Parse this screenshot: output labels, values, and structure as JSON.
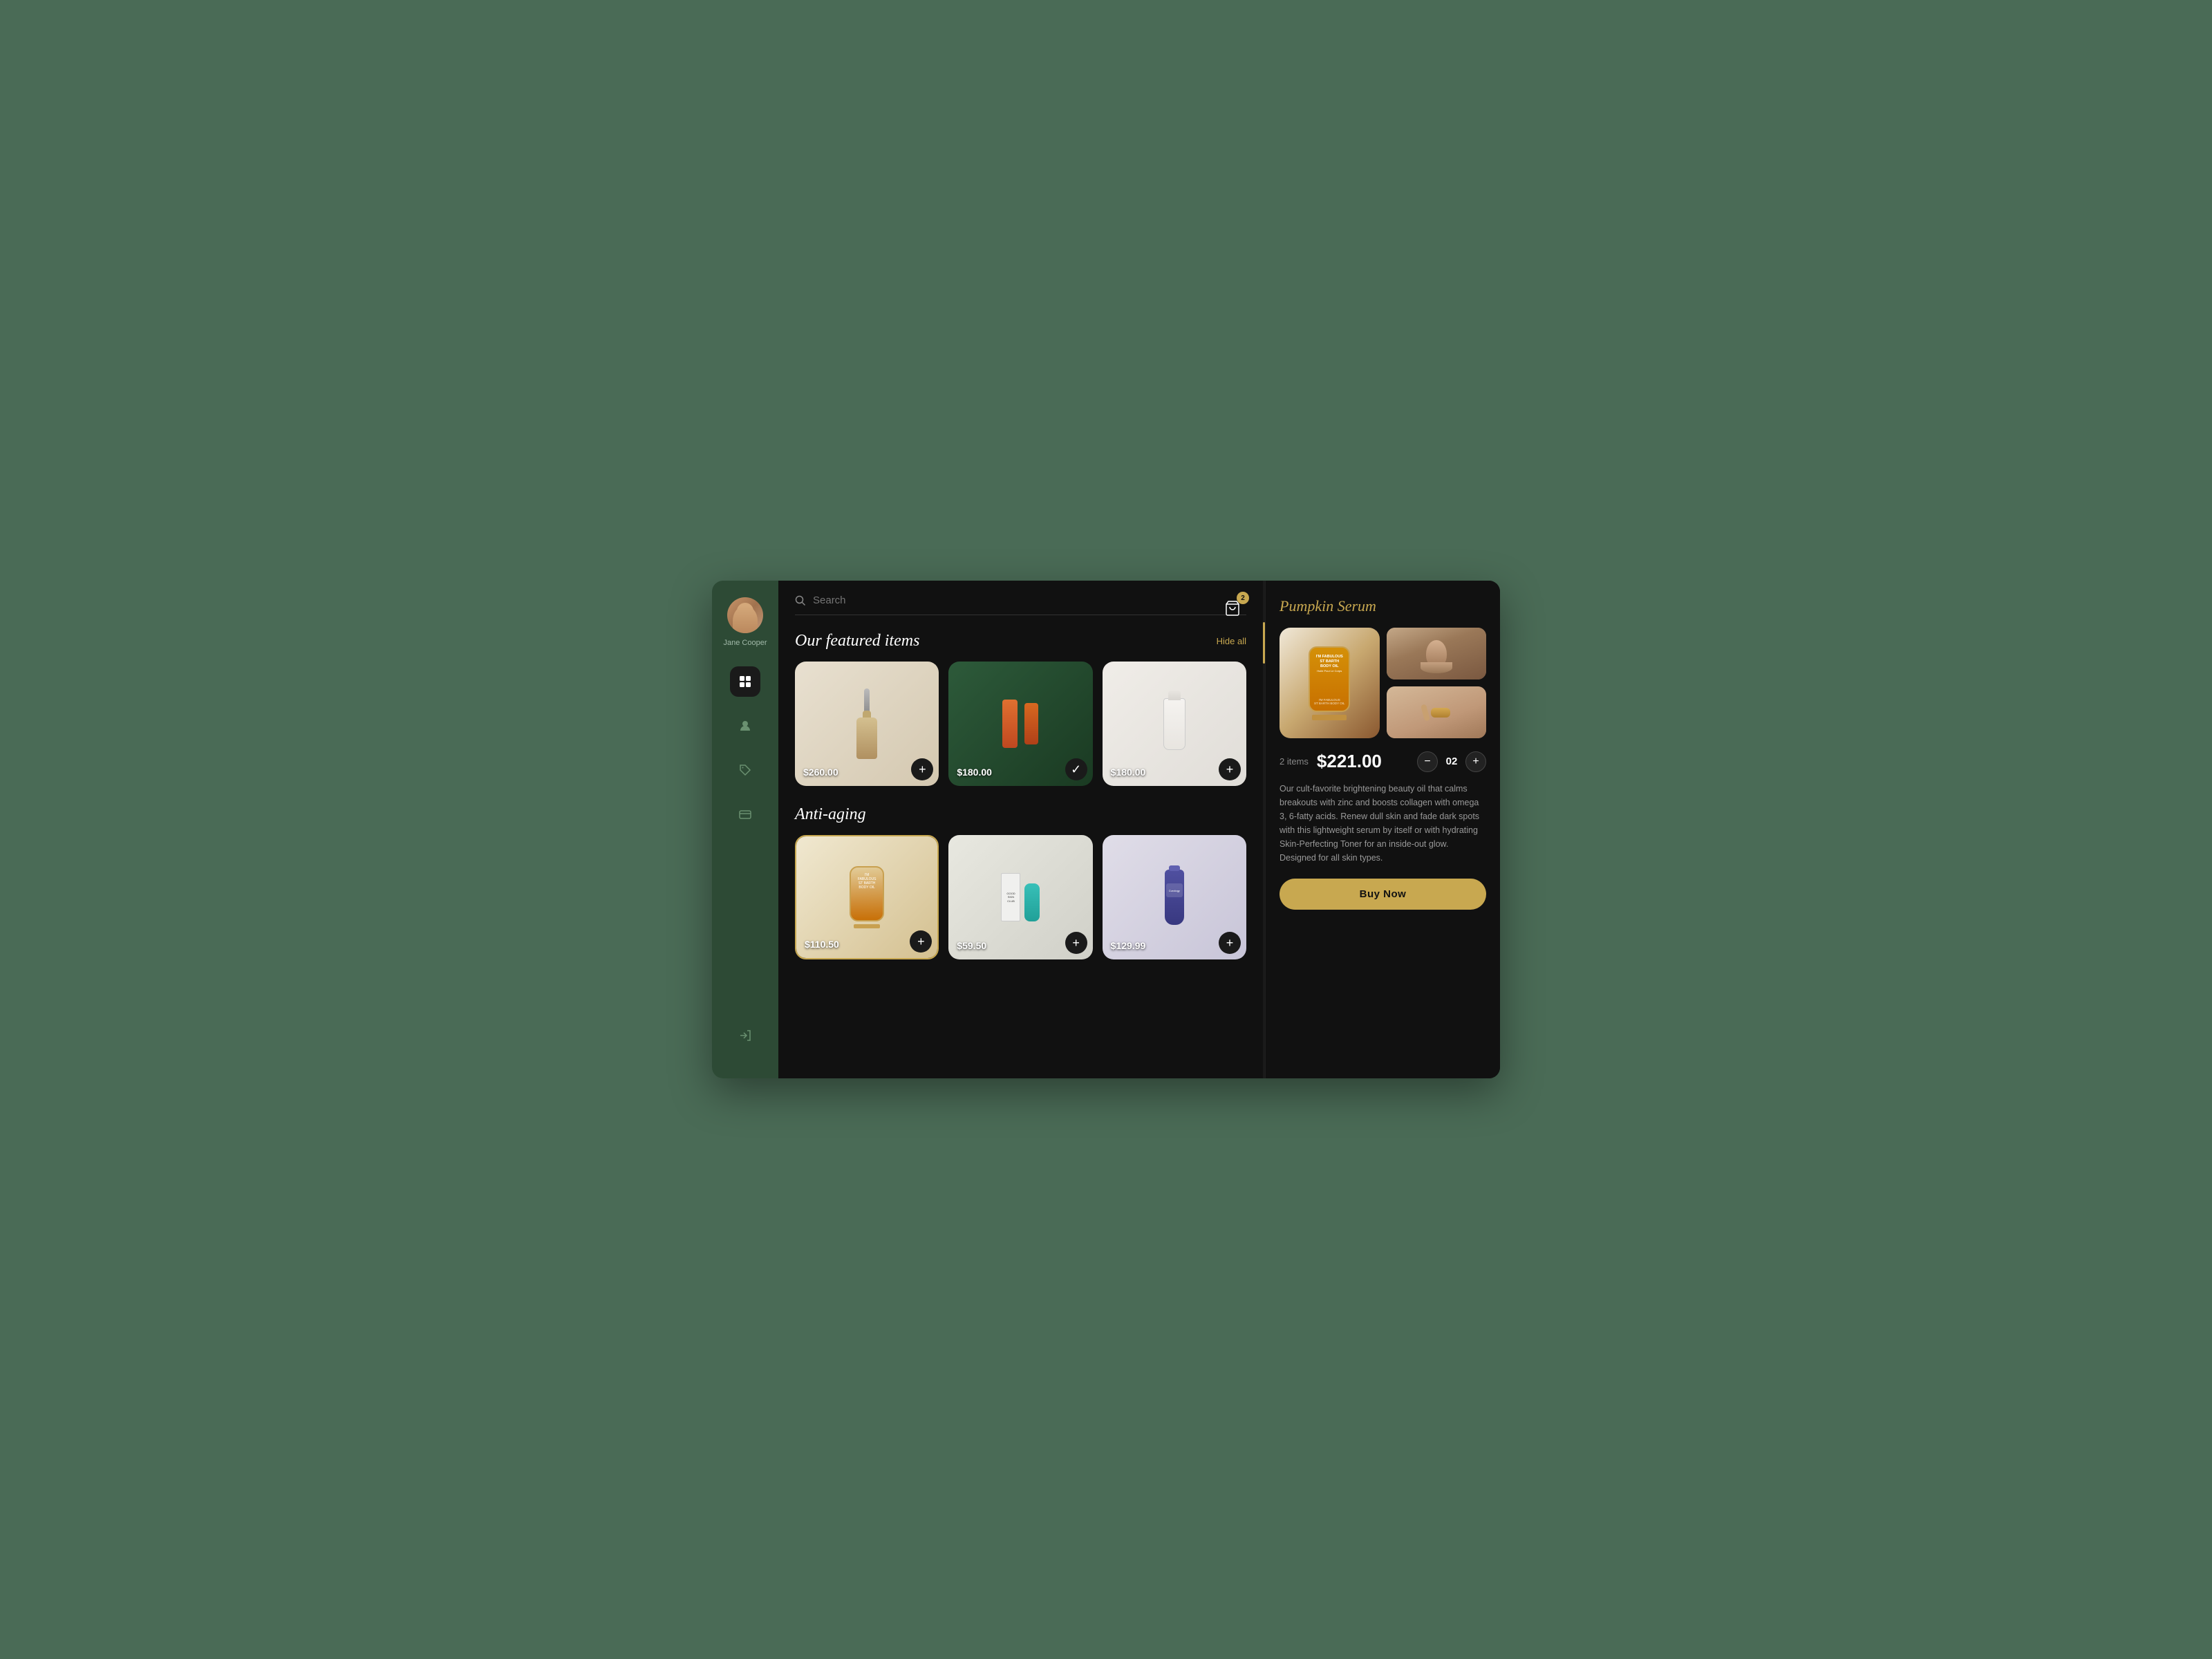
{
  "sidebar": {
    "user": {
      "name": "Jane Cooper"
    },
    "nav_items": [
      {
        "id": "grid",
        "icon": "grid",
        "active": true
      },
      {
        "id": "profile",
        "icon": "person",
        "active": false
      },
      {
        "id": "tag",
        "icon": "tag",
        "active": false
      },
      {
        "id": "card",
        "icon": "card",
        "active": false
      }
    ],
    "logout_icon": "logout"
  },
  "header": {
    "search_placeholder": "Search",
    "cart_count": "2"
  },
  "featured": {
    "title": "Our featured items",
    "hide_label": "Hide all",
    "products": [
      {
        "id": 1,
        "price": "$260.00",
        "selected": false,
        "img_class": "img-serum"
      },
      {
        "id": 2,
        "price": "$180.00",
        "selected": true,
        "img_class": "img-orange"
      },
      {
        "id": 3,
        "price": "$180.00",
        "selected": false,
        "img_class": "img-white"
      }
    ]
  },
  "antiaging": {
    "title": "Anti-aging",
    "products": [
      {
        "id": 4,
        "price": "$110.50",
        "selected": true,
        "img_class": "img-bottle"
      },
      {
        "id": 5,
        "price": "$59.50",
        "selected": false,
        "img_class": "img-skinclub"
      },
      {
        "id": 6,
        "price": "$129.99",
        "selected": false,
        "img_class": "img-purple"
      }
    ]
  },
  "detail": {
    "title": "Pumpkin Serum",
    "items_count": "2 items",
    "price": "$221.00",
    "quantity": "02",
    "description": "Our cult-favorite brightening beauty oil that calms breakouts with zinc and boosts collagen with omega 3, 6-fatty acids. Renew dull skin and fade dark spots with this lightweight serum by itself or with hydrating Skin-Perfecting Toner for an inside-out glow. Designed for all skin types.",
    "buy_label": "Buy Now"
  },
  "colors": {
    "accent": "#c8a850",
    "bg_main": "#111111",
    "bg_sidebar": "#2d4a35",
    "text_muted": "#888888"
  }
}
